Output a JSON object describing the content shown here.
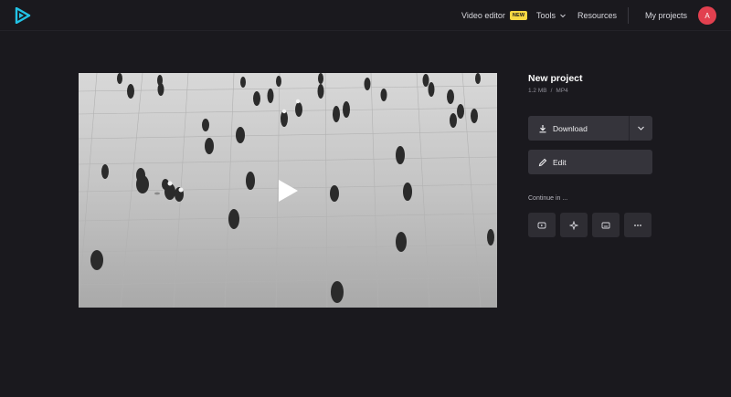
{
  "brand": {
    "logo_icon": "play-triangle-logo-icon",
    "accent": "#22c3e6"
  },
  "nav": {
    "video_editor": "Video editor",
    "new_badge": "NEW",
    "tools": "Tools",
    "resources": "Resources",
    "my_projects": "My projects",
    "avatar_initial": "A"
  },
  "video": {
    "play_icon": "play-icon"
  },
  "project": {
    "title": "New project",
    "size": "1.2 MB",
    "separator": "/",
    "format": "MP4"
  },
  "actions": {
    "download": "Download",
    "edit": "Edit"
  },
  "continue": {
    "label": "Continue in ...",
    "tiles": [
      "youtube-icon",
      "compass-icon",
      "subtitles-icon",
      "more-icon"
    ]
  }
}
